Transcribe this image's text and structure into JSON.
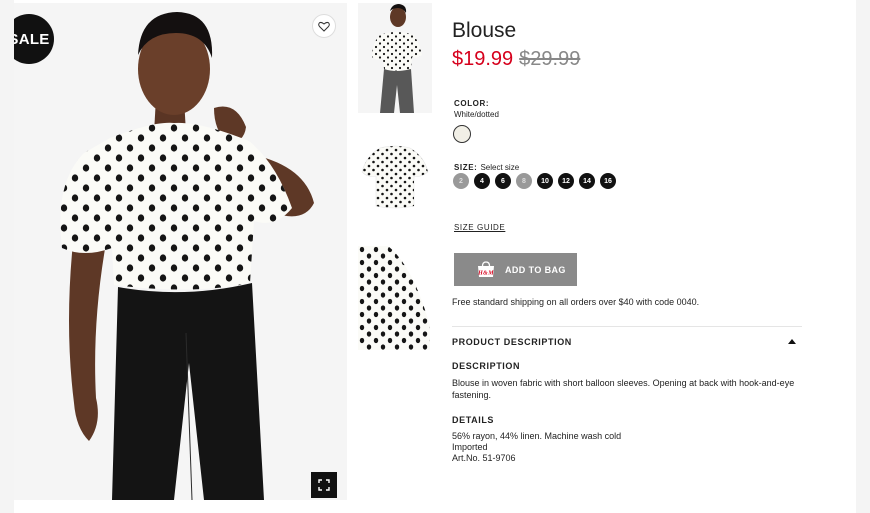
{
  "badge": {
    "sale": "SALE"
  },
  "product": {
    "title": "Blouse",
    "price_sale": "$19.99",
    "price_original": "$29.99",
    "color_label": "COLOR:",
    "color_value": "White/dotted",
    "size_label": "SIZE:",
    "size_placeholder": "Select size",
    "sizes": [
      {
        "label": "2",
        "available": false
      },
      {
        "label": "4",
        "available": true
      },
      {
        "label": "6",
        "available": true
      },
      {
        "label": "8",
        "available": false
      },
      {
        "label": "10",
        "available": true
      },
      {
        "label": "12",
        "available": true
      },
      {
        "label": "14",
        "available": true
      },
      {
        "label": "16",
        "available": true
      }
    ],
    "size_guide": "SIZE GUIDE",
    "add_to_bag": "ADD TO BAG",
    "bag_logo": "H&M",
    "shipping_note": "Free standard shipping on all orders over $40 with code 0040."
  },
  "description_section": {
    "heading": "PRODUCT DESCRIPTION",
    "description_label": "DESCRIPTION",
    "description_text": "Blouse in woven fabric with short balloon sleeves. Opening at back with hook-and-eye fastening.",
    "details_label": "DETAILS",
    "details_lines": [
      "56% rayon, 44% linen. Machine wash cold",
      "Imported",
      "Art.No. 51-9706"
    ]
  },
  "icons": {
    "favorite": "heart-icon",
    "fullscreen": "expand-icon",
    "collapse": "caret-up-icon",
    "bag": "shopping-bag-icon"
  },
  "colors": {
    "sale_price": "#d6001c",
    "add_to_bag_bg": "#8a8a8a",
    "size_available": "#111111",
    "size_unavailable": "#999999"
  }
}
